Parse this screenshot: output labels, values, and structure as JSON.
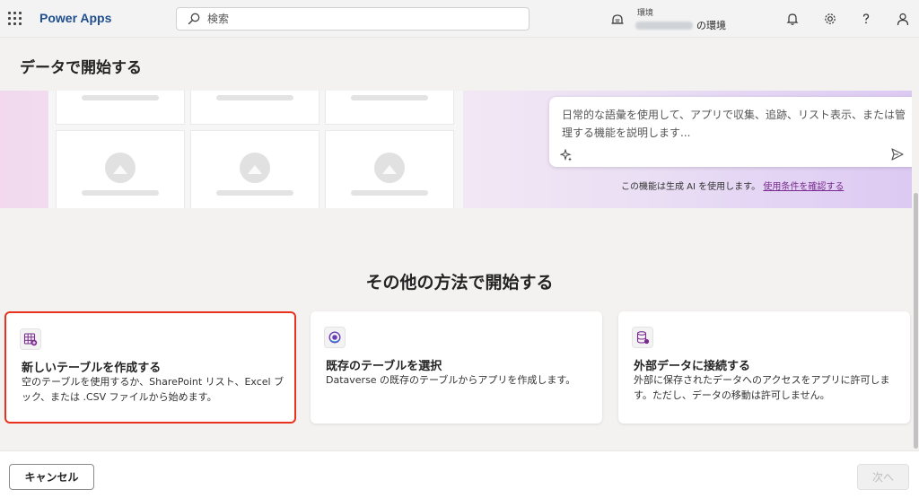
{
  "topbar": {
    "app_name": "Power Apps",
    "search_placeholder": "検索",
    "environment_label": "環境",
    "environment_suffix": "の環境",
    "icons": [
      "waffle-icon",
      "search-icon",
      "environment-icon",
      "bell-icon",
      "gear-icon",
      "help-icon",
      "person-icon"
    ]
  },
  "page": {
    "title": "データで開始する"
  },
  "hero": {
    "prompt_placeholder": "日常的な語彙を使用して、アプリで収集、追跡、リスト表示、または管理する機能を説明します...",
    "ai_notice": "この機能は生成 AI を使用します。",
    "terms_link": "使用条件を確認する"
  },
  "section": {
    "title": "その他の方法で開始する"
  },
  "cards": [
    {
      "title": "新しいテーブルを作成する",
      "description": "空のテーブルを使用するか、SharePoint リスト、Excel ブック、または .CSV ファイルから始めます。",
      "icon": "table-add-icon",
      "selected": true
    },
    {
      "title": "既存のテーブルを選択",
      "description": "Dataverse の既存のテーブルからアプリを作成します。",
      "icon": "dataverse-icon",
      "selected": false
    },
    {
      "title": "外部データに接続する",
      "description": "外部に保存されたデータへのアクセスをアプリに許可します。ただし、データの移動は許可しません。",
      "icon": "database-link-icon",
      "selected": false
    }
  ],
  "footer": {
    "cancel_label": "キャンセル",
    "next_label": "次へ"
  },
  "colors": {
    "brand": "#1f4e8c",
    "selection_border": "#e8321e",
    "link": "#7a2b8f"
  }
}
